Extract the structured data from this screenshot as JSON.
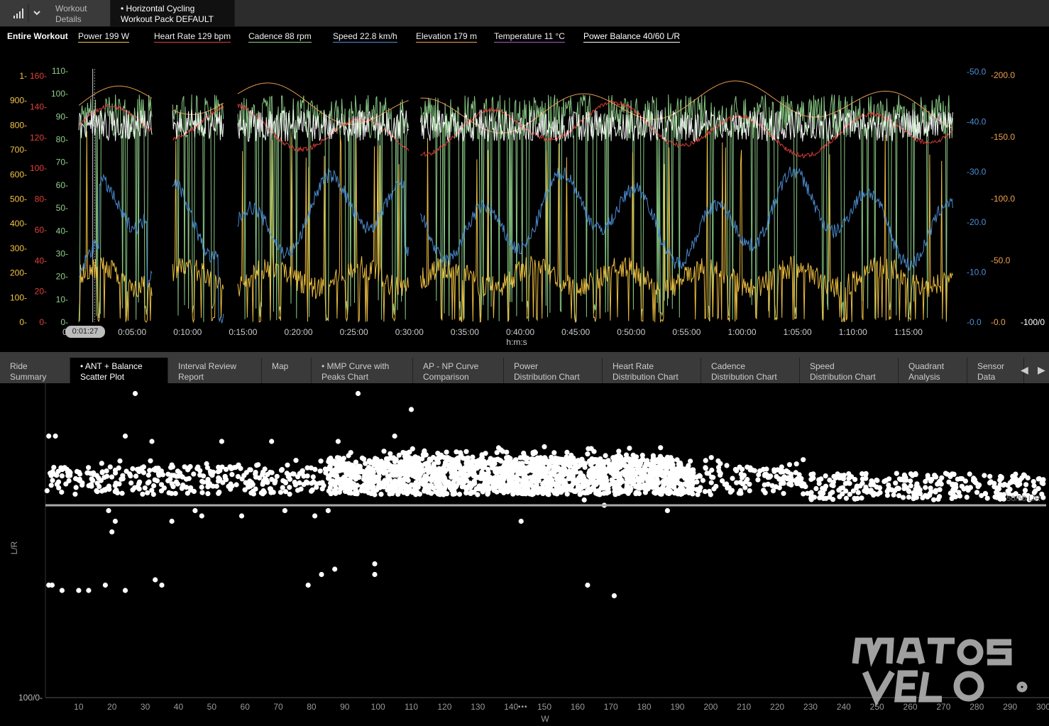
{
  "top_tabs": [
    {
      "label": "Workout\nDetails",
      "active": false
    },
    {
      "label": "• Horizontal Cycling\nWorkout Pack DEFAULT",
      "active": true
    }
  ],
  "legend": {
    "scope": "Entire Workout",
    "items": [
      {
        "label": "Power  199 W",
        "color": "#f5c542"
      },
      {
        "label": "Heart Rate  129 bpm",
        "color": "#e0403a"
      },
      {
        "label": "Cadence  88 rpm",
        "color": "#8fd18a"
      },
      {
        "label": "Speed  22.8 km/h",
        "color": "#4c8fd6"
      },
      {
        "label": "Elevation  179 m",
        "color": "#f0a052"
      },
      {
        "label": "Temperature  11 °C",
        "color": "#b05ad0"
      },
      {
        "label": "Power Balance  40/60 L/R",
        "color": "#ffffff"
      }
    ]
  },
  "cursor_time": "0:01:27",
  "chart_data": [
    {
      "type": "line",
      "xlabel": "h:m:s",
      "x_ticks": [
        "0:0",
        "0:05:00",
        "0:10:00",
        "0:15:00",
        "0:20:00",
        "0:25:00",
        "0:30:00",
        "0:35:00",
        "0:40:00",
        "0:45:00",
        "0:50:00",
        "0:55:00",
        "1:00:00",
        "1:05:00",
        "1:10:00",
        "1:15:00"
      ],
      "x_range_min": [
        0,
        80
      ],
      "axes": {
        "balance": {
          "ticks": [
            "1-",
            "900-",
            "800-",
            "700-",
            "600-",
            "500-",
            "400-",
            "300-",
            "200-",
            "100-",
            "0-"
          ],
          "color": "#f5c542"
        },
        "heart_rate": {
          "ticks": [
            "160-",
            "140-",
            "120-",
            "100-",
            "80-",
            "60-",
            "40-",
            "20-",
            "0-"
          ],
          "color": "#e0403a"
        },
        "cadence": {
          "ticks": [
            "110-",
            "100-",
            "90-",
            "80-",
            "70-",
            "60-",
            "50-",
            "40-",
            "30-",
            "20-",
            "10-",
            "0-"
          ],
          "color": "#8fd18a"
        },
        "speed": {
          "ticks": [
            "-50.0",
            "-40.0",
            "-30.0",
            "-20.0",
            "-10.0",
            "-0.0"
          ],
          "color": "#4c8fd6"
        },
        "elevation": {
          "ticks": [
            "-200.0",
            "-150.0",
            "-100.0",
            "-50.0",
            "-0.0"
          ],
          "color": "#f0a052"
        },
        "balance_right": {
          "ticks": [
            "-100/0"
          ],
          "color": "#ffffff"
        }
      },
      "series": [
        {
          "name": "Power",
          "unit": "W",
          "mean": 199,
          "color": "#f5c542"
        },
        {
          "name": "Heart Rate",
          "unit": "bpm",
          "mean": 129,
          "range": [
            0,
            165
          ],
          "color": "#e0403a"
        },
        {
          "name": "Cadence",
          "unit": "rpm",
          "mean": 88,
          "range": [
            0,
            110
          ],
          "color": "#8fd18a"
        },
        {
          "name": "Speed",
          "unit": "km/h",
          "mean": 22.8,
          "range": [
            0,
            50
          ],
          "color": "#4c8fd6"
        },
        {
          "name": "Elevation",
          "unit": "m",
          "mean": 179,
          "range": [
            0,
            200
          ],
          "color": "#f0a052"
        },
        {
          "name": "Power Balance",
          "unit": "L/R",
          "mean": "40/60",
          "color": "#ffffff"
        }
      ],
      "gaps_minutes": [
        [
          6.8,
          8.6
        ],
        [
          13.3,
          14.5
        ],
        [
          30.0,
          31.0
        ]
      ]
    },
    {
      "type": "scatter",
      "title": "ANT + Balance Scatter Plot",
      "xlabel": "W",
      "ylabel": "L/R",
      "xlim": [
        0,
        300
      ],
      "x_ticks": [
        10,
        20,
        30,
        40,
        50,
        60,
        70,
        80,
        90,
        100,
        110,
        120,
        130,
        140,
        150,
        160,
        170,
        180,
        190,
        200,
        210,
        220,
        230,
        240,
        250,
        260,
        270,
        280,
        290,
        300
      ],
      "y_bottom_label": "100/0-",
      "reference_label": "50/50 L/R",
      "dense_band_L": [
        52,
        59
      ],
      "outliers": [
        [
          1,
          35
        ],
        [
          2,
          35
        ],
        [
          5,
          34
        ],
        [
          10,
          34
        ],
        [
          13,
          34
        ],
        [
          18,
          35
        ],
        [
          24,
          34
        ],
        [
          33,
          36
        ],
        [
          35,
          35
        ],
        [
          47,
          48
        ],
        [
          79,
          35
        ],
        [
          83,
          37
        ],
        [
          87,
          38
        ],
        [
          99,
          37
        ],
        [
          99,
          39
        ],
        [
          163,
          35
        ],
        [
          171,
          33
        ],
        [
          27,
          71
        ],
        [
          94,
          71
        ],
        [
          110,
          68
        ],
        [
          1,
          63
        ],
        [
          3,
          63
        ],
        [
          24,
          63
        ],
        [
          32,
          62
        ],
        [
          53,
          62
        ],
        [
          68,
          62
        ],
        [
          88,
          62
        ],
        [
          105,
          63
        ],
        [
          150,
          61
        ],
        [
          20,
          45
        ],
        [
          21,
          47
        ],
        [
          19,
          49
        ],
        [
          38,
          47
        ],
        [
          45,
          49
        ],
        [
          59,
          48
        ],
        [
          72,
          49
        ],
        [
          81,
          48
        ],
        [
          85,
          49
        ],
        [
          162,
          51
        ],
        [
          168,
          50
        ],
        [
          187,
          49
        ],
        [
          143,
          47
        ],
        [
          200,
          52
        ],
        [
          228,
          54
        ],
        [
          290,
          53
        ]
      ]
    }
  ],
  "bottom_tabs": [
    {
      "label": "Ride\nSummary",
      "active": false
    },
    {
      "label": "• ANT + Balance\nScatter Plot",
      "active": true
    },
    {
      "label": "Interval Review\nReport",
      "active": false
    },
    {
      "label": "Map",
      "active": false
    },
    {
      "label": "• MMP Curve with\nPeaks Chart",
      "active": false
    },
    {
      "label": "AP - NP Curve\nComparison",
      "active": false
    },
    {
      "label": "Power\nDistribution Chart",
      "active": false
    },
    {
      "label": "Heart Rate\nDistribution Chart",
      "active": false
    },
    {
      "label": "Cadence\nDistribution Chart",
      "active": false
    },
    {
      "label": "Speed\nDistribution Chart",
      "active": false
    },
    {
      "label": "Quadrant\nAnalysis",
      "active": false
    },
    {
      "label": "Sensor\nData",
      "active": false
    }
  ],
  "icons": {
    "menu": "signal-bars-icon",
    "dropdown": "chevron-down-icon",
    "prev": "arrow-left-icon",
    "next": "arrow-right-icon"
  },
  "watermark": "matos vélo"
}
